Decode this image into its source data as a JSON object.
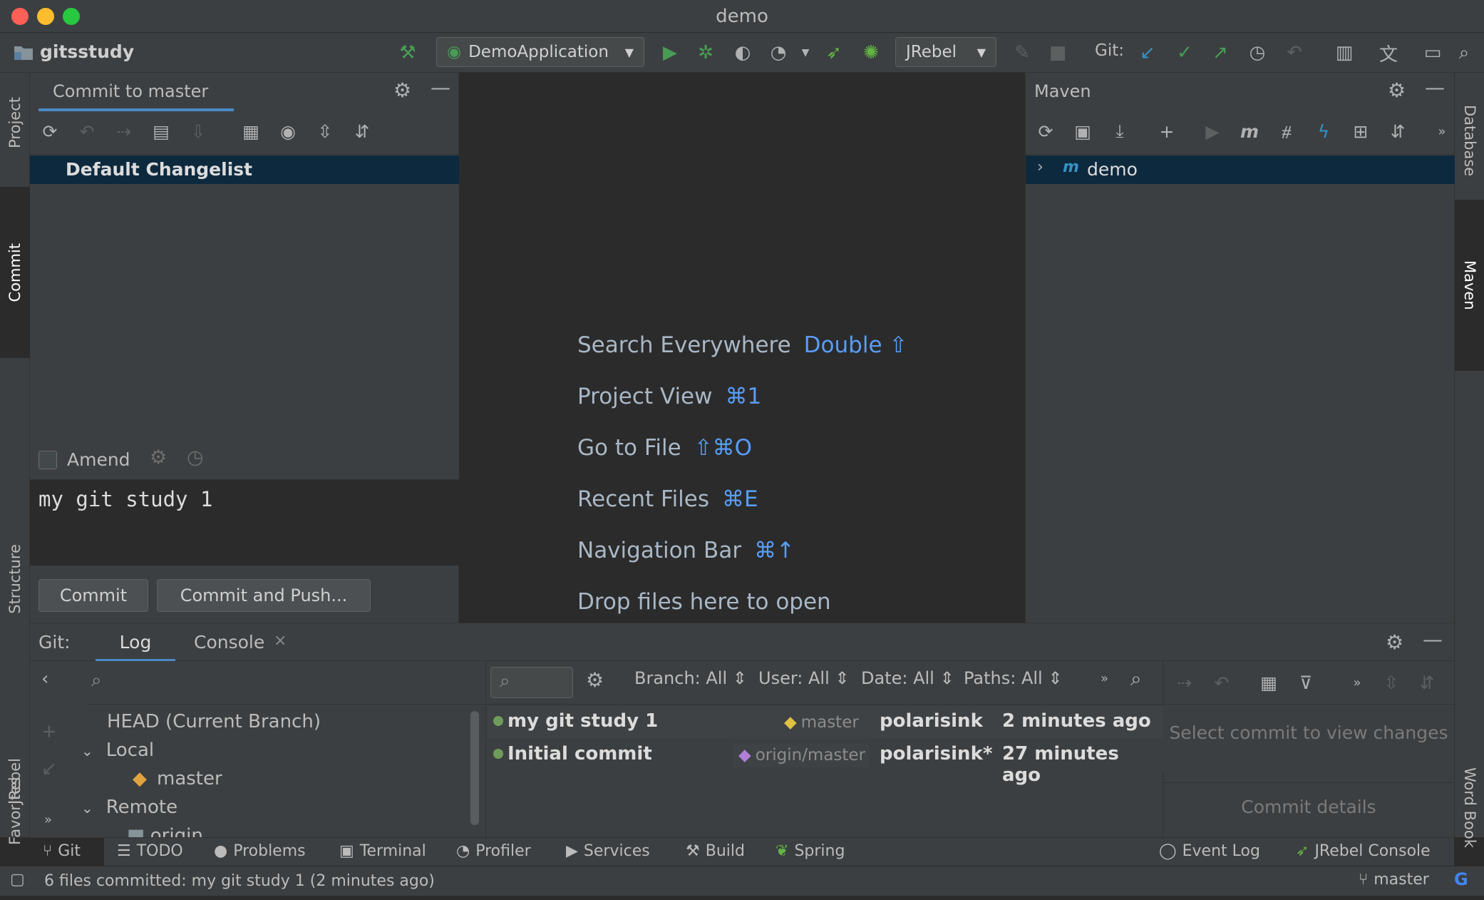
{
  "window": {
    "title": "demo"
  },
  "toolbar": {
    "project_name": "gitsstudy",
    "run_config": "DemoApplication",
    "jrebel_config": "JRebel",
    "git_label": "Git:"
  },
  "commit_panel": {
    "title": "Commit to master",
    "changelist": "Default Changelist",
    "amend_label": "Amend",
    "message": "my git study 1",
    "commit_button": "Commit",
    "commit_push_button": "Commit and Push..."
  },
  "editor": {
    "hints": [
      {
        "label": "Search Everywhere",
        "shortcut": "Double ⇧"
      },
      {
        "label": "Project View",
        "shortcut": "⌘1"
      },
      {
        "label": "Go to File",
        "shortcut": "⇧⌘O"
      },
      {
        "label": "Recent Files",
        "shortcut": "⌘E"
      },
      {
        "label": "Navigation Bar",
        "shortcut": "⌘↑"
      },
      {
        "label": "Drop files here to open",
        "shortcut": ""
      }
    ]
  },
  "maven_panel": {
    "title": "Maven",
    "root_item": "demo"
  },
  "left_stripe": {
    "project": "Project",
    "commit": "Commit",
    "structure": "Structure",
    "favorites": "Favorites",
    "jrebel": "JRebel"
  },
  "right_stripe": {
    "database": "Database",
    "maven": "Maven",
    "wordbook": "Word Book"
  },
  "git_tool": {
    "label": "Git:",
    "tabs": [
      {
        "label": "Log"
      },
      {
        "label": "Console"
      }
    ],
    "filters": {
      "branch": "Branch: All",
      "user": "User: All",
      "date": "Date: All",
      "paths": "Paths: All"
    },
    "branches": {
      "head": "HEAD (Current Branch)",
      "local": "Local",
      "local_master": "master",
      "remote": "Remote",
      "origin": "origin"
    },
    "commits": [
      {
        "message": "my git study 1",
        "ref": "master",
        "author": "polarisink",
        "time": "2 minutes ago"
      },
      {
        "message": "Initial commit",
        "ref": "origin/master",
        "author": "polarisink*",
        "time": "27 minutes ago"
      }
    ],
    "details": {
      "empty_text": "Select commit to view changes",
      "details_label": "Commit details"
    }
  },
  "tool_window_bar": {
    "items": [
      "Git",
      "TODO",
      "Problems",
      "Terminal",
      "Profiler",
      "Services",
      "Build",
      "Spring"
    ],
    "right_items": [
      "Event Log",
      "JRebel Console"
    ]
  },
  "status": {
    "message": "6 files committed: my git study 1 (2 minutes ago)",
    "branch": "master"
  },
  "colors": {
    "accent": "#589df6",
    "selection": "#0d293e",
    "run_green": "#499c54",
    "tab_underline": "#4a88c7"
  }
}
